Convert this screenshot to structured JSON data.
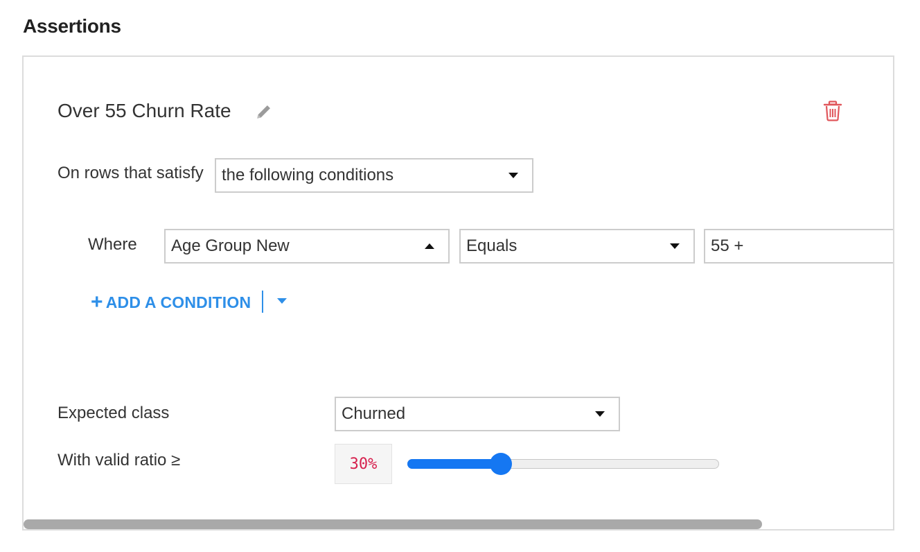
{
  "section": {
    "title": "Assertions"
  },
  "assertion": {
    "name": "Over 55 Churn Rate",
    "rows_label": "On rows that satisfy",
    "rows_filter": "the following conditions",
    "where_label": "Where",
    "condition": {
      "column": "Age Group New",
      "operator": "Equals",
      "value": "55 +"
    },
    "add_condition_label": "ADD A CONDITION",
    "expected_class_label": "Expected class",
    "expected_class": "Churned",
    "valid_ratio_label": "With valid ratio ≥",
    "valid_ratio_display": "30%",
    "valid_ratio": 0.3
  },
  "colors": {
    "accent": "#2e8fe8",
    "slider": "#1577f2",
    "delete": "#e0565b",
    "ratio_text": "#d6214e"
  },
  "icons": {
    "edit": "pencil-icon",
    "delete": "trash-icon",
    "add": "plus-icon"
  }
}
